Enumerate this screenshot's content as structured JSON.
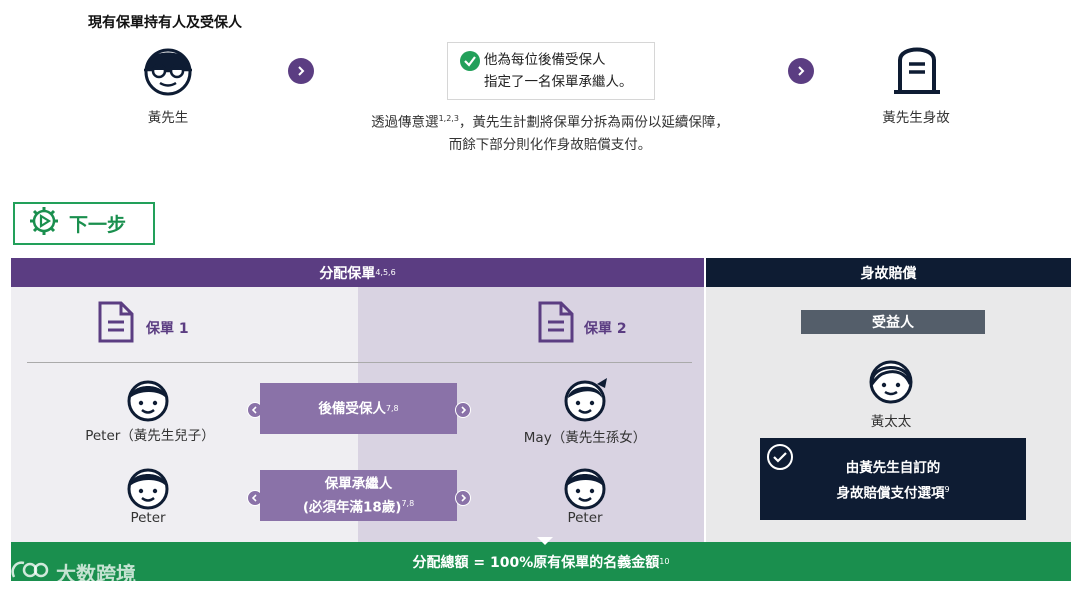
{
  "top": {
    "title": "現有保單持有人及受保人",
    "left_person": "黃先生",
    "callout_line1": "他為每位後備受保人",
    "callout_line2": "指定了一名保單承繼人。",
    "desc_line1_pre": "透過傳意選",
    "desc_line1_sup": "1,2,3",
    "desc_line1_post": "，黃先生計劃將保單分拆為兩份以延續保障，",
    "desc_line2": "而餘下部分則化作身故賠償支付。",
    "right_person": "黃先生身故"
  },
  "next_step": {
    "label": "下一步"
  },
  "allocation": {
    "header": "分配保單",
    "header_sup": "4,5,6",
    "policy1": "保單 1",
    "policy2": "保單 2",
    "row1_role": "後備受保人",
    "row1_sup": "7,8",
    "row1_left_person": "Peter（黃先生兒子）",
    "row1_right_person": "May（黃先生孫女）",
    "row2_role_line1": "保單承繼人",
    "row2_role_line2": "(必須年滿18歲)",
    "row2_sup": "7,8",
    "row2_left_person": "Peter",
    "row2_right_person": "Peter"
  },
  "death_benefit": {
    "header": "身故賠償",
    "beneficiary_label": "受益人",
    "beneficiary_name": "黃太太",
    "option_line1": "由黃先生自訂的",
    "option_line2": "身故賠償支付選項",
    "option_sup": "9"
  },
  "footer": {
    "text": "分配總額 = 100%原有保單的名義金額",
    "sup": "10"
  },
  "watermark": {
    "text": "大数跨境"
  },
  "colors": {
    "purple": "#5b3d82",
    "light_purple": "#8a72a8",
    "navy": "#0e1c33",
    "green": "#1a8f4e"
  }
}
